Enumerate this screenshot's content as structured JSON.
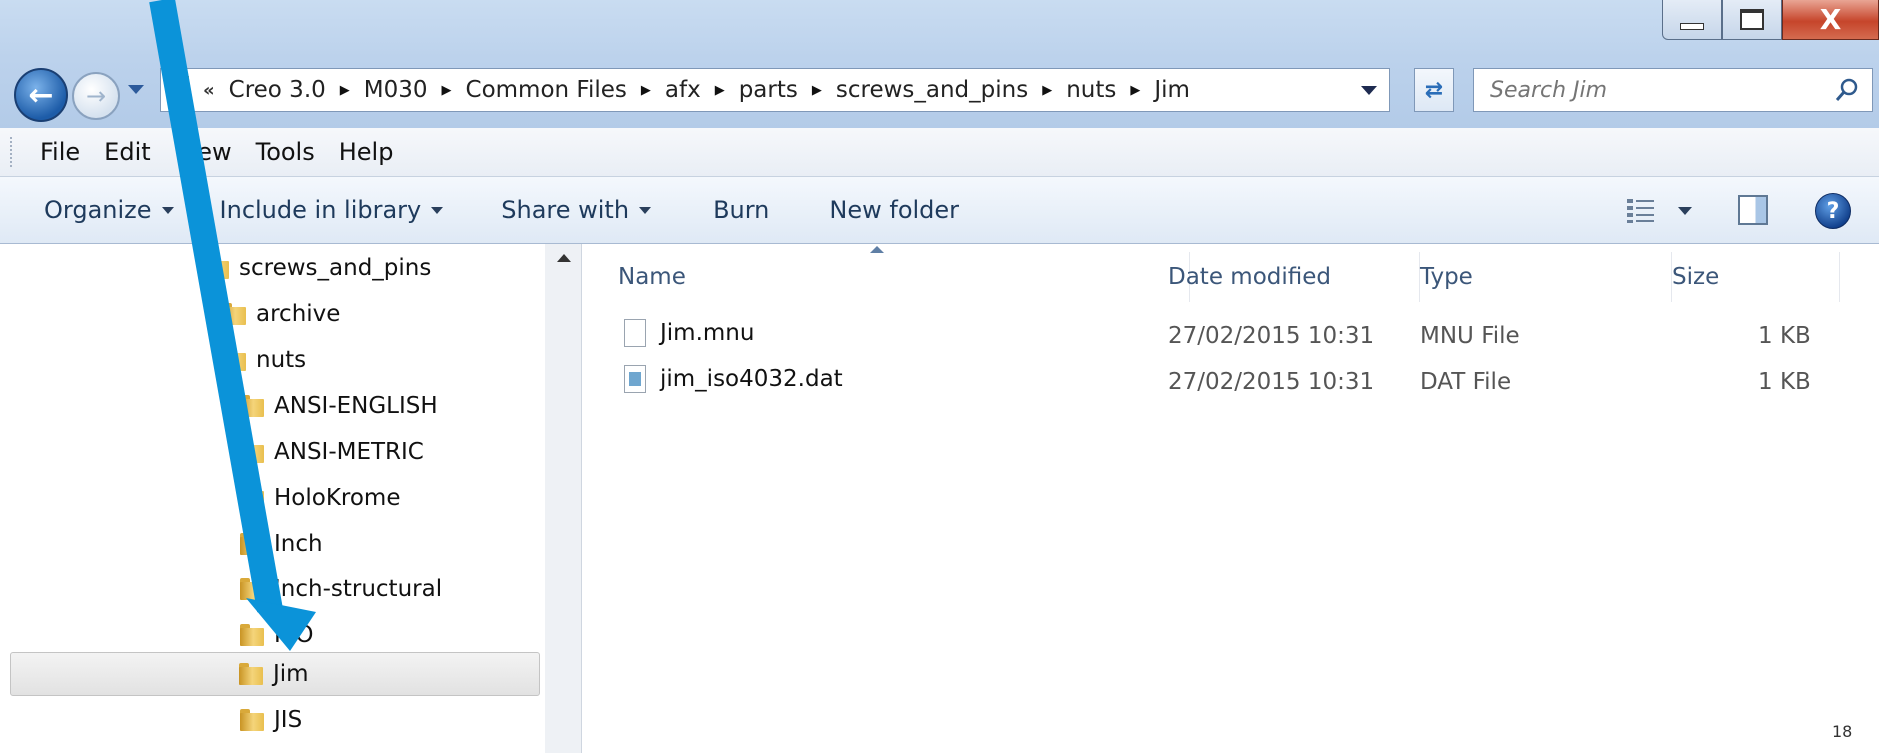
{
  "window": {
    "close_label": "X"
  },
  "address": {
    "overflow": "«",
    "crumbs": [
      "Creo 3.0",
      "M030",
      "Common Files",
      "afx",
      "parts",
      "screws_and_pins",
      "nuts",
      "Jim"
    ]
  },
  "search": {
    "placeholder": "Search Jim"
  },
  "menu": {
    "items": [
      "File",
      "Edit",
      "View",
      "Tools",
      "Help"
    ]
  },
  "toolbar": {
    "organize": "Organize",
    "include": "Include in library",
    "share": "Share with",
    "burn": "Burn",
    "new_folder": "New folder",
    "help": "?"
  },
  "tree": {
    "items": [
      "screws_and_pins",
      "archive",
      "nuts",
      "ANSI-ENGLISH",
      "ANSI-METRIC",
      "HoloKrome",
      "Inch",
      "Inch-structural",
      "ISO",
      "Jim",
      "JIS"
    ],
    "selected": "Jim"
  },
  "columns": {
    "name": "Name",
    "date": "Date modified",
    "type": "Type",
    "size": "Size"
  },
  "files": [
    {
      "name": "Jim.mnu",
      "date": "27/02/2015 10:31",
      "type": "MNU File",
      "size": "1 KB",
      "icon": "generic-file-icon"
    },
    {
      "name": "jim_iso4032.dat",
      "date": "27/02/2015 10:31",
      "type": "DAT File",
      "size": "1 KB",
      "icon": "dat-file-icon"
    }
  ],
  "slide": {
    "page_number": "18"
  },
  "colors": {
    "annotation_arrow": "#0b93d9",
    "title_bar": "#bcd2ec",
    "close_button": "#c6452b"
  }
}
